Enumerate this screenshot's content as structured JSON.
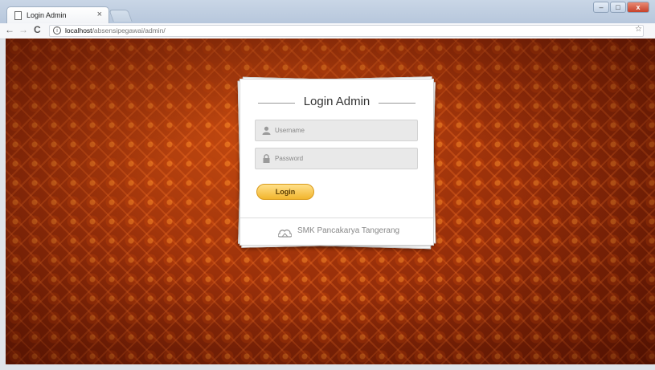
{
  "browser": {
    "tab_title": "Login Admin",
    "tab_close": "×",
    "url_host": "localhost",
    "url_path": "/absensipegawai/admin/",
    "nav": {
      "back": "←",
      "forward": "→",
      "reload": "C"
    },
    "info_glyph": "i",
    "star_glyph": "☆",
    "window_buttons": {
      "minimize": "–",
      "maximize": "□",
      "close": "x"
    }
  },
  "login": {
    "title": "Login Admin",
    "username_placeholder": "Username",
    "password_placeholder": "Password",
    "button_label": "Login",
    "footer_text": "SMK Pancakarya Tangerang"
  },
  "icons": {
    "user": "user-icon",
    "lock": "lock-icon",
    "footer": "cloud-icon"
  },
  "colors": {
    "background": "#8f2a08",
    "button": "#f2b52d"
  }
}
